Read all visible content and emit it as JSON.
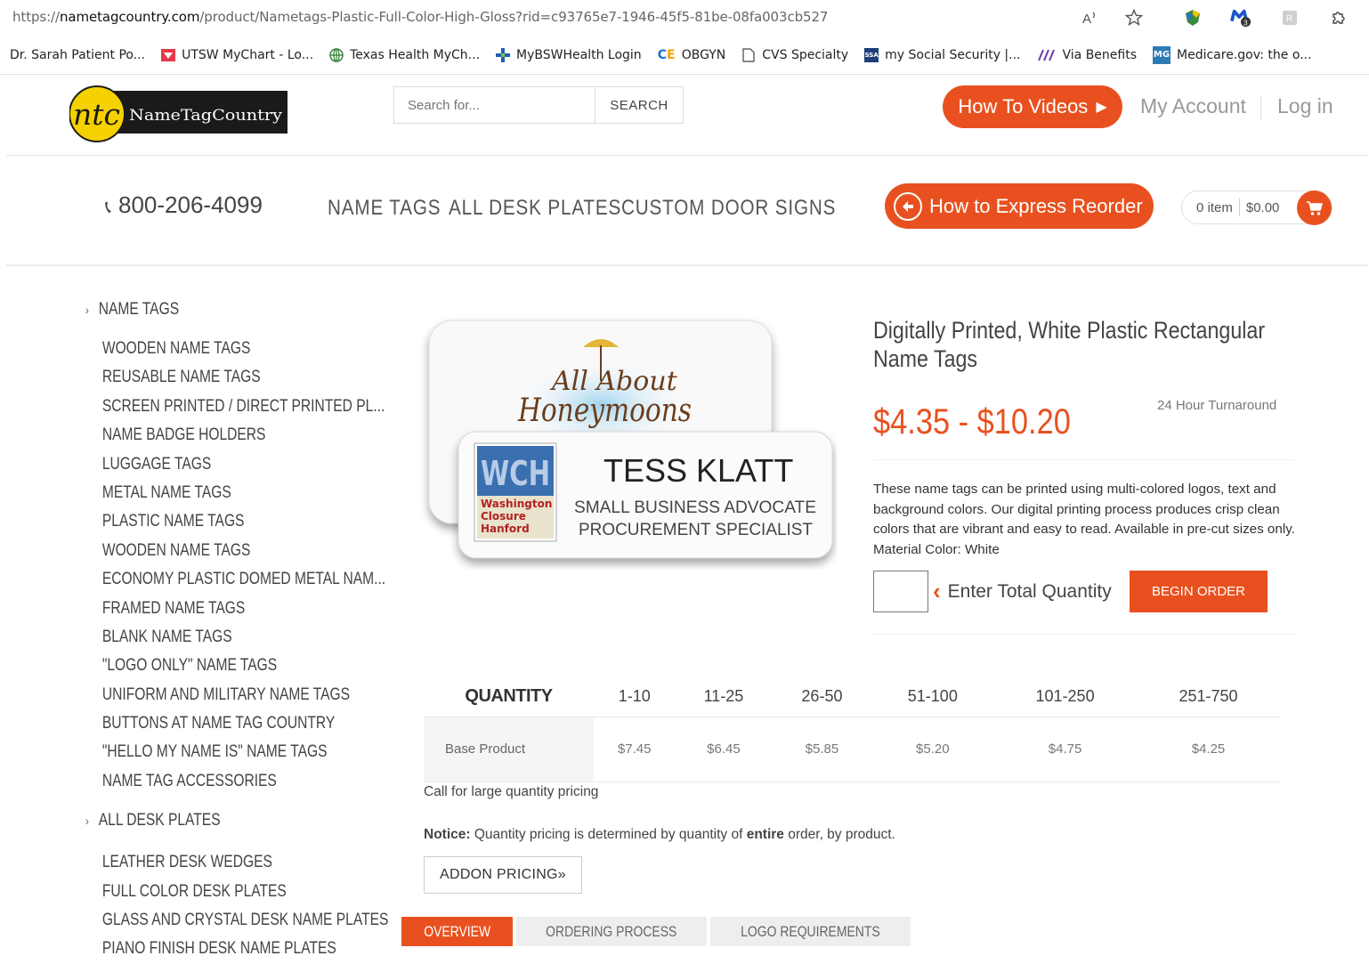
{
  "browser": {
    "url_prefix": "https://",
    "url_domain": "nametagcountry.com",
    "url_path": "/product/Nametags-Plastic-Full-Color-High-Gloss?rid=c93765e7-1946-45f5-81be-08fa003cb527",
    "extension_badge": "3"
  },
  "bookmarks": [
    {
      "label": "Dr. Sarah Patient Po...",
      "icon": "none"
    },
    {
      "label": "UTSW MyChart - Lo...",
      "icon": "utsw-icon"
    },
    {
      "label": "Texas Health MyCh...",
      "icon": "globe-icon"
    },
    {
      "label": "MyBSWHealth Login",
      "icon": "bsw-icon"
    },
    {
      "label": "OBGYN",
      "icon": "ce-icon"
    },
    {
      "label": "CVS Specialty",
      "icon": "page-icon"
    },
    {
      "label": "my Social Security |...",
      "icon": "ssa-icon"
    },
    {
      "label": "Via Benefits",
      "icon": "via-icon"
    },
    {
      "label": "Medicare.gov: the o...",
      "icon": "medicare-icon"
    }
  ],
  "header": {
    "logo_mark": "ntc",
    "logo_text": "NameTagCountry",
    "search_placeholder": "Search for...",
    "search_button": "SEARCH",
    "how_to_videos": "How To Videos",
    "my_account": "My Account",
    "log_in": "Log in"
  },
  "nav": {
    "phone": "800-206-4099",
    "items": [
      "NAME TAGS",
      "ALL DESK PLATES",
      "CUSTOM DOOR SIGNS"
    ],
    "express_reorder": "How to Express Reorder",
    "cart_items": "0 item",
    "cart_total": "$0.00"
  },
  "sidebar": {
    "groups": [
      {
        "heading": "NAME TAGS",
        "items": [
          "WOODEN NAME TAGS",
          "REUSABLE NAME TAGS",
          "SCREEN PRINTED / DIRECT PRINTED PL...",
          "NAME BADGE HOLDERS",
          "LUGGAGE TAGS",
          "METAL NAME TAGS",
          "PLASTIC NAME TAGS",
          "WOODEN NAME TAGS",
          "ECONOMY PLASTIC DOMED METAL NAM...",
          "FRAMED NAME TAGS",
          "BLANK NAME TAGS",
          "\"LOGO ONLY\" NAME TAGS",
          "UNIFORM AND MILITARY NAME TAGS",
          "BUTTONS AT NAME TAG COUNTRY",
          "\"HELLO MY NAME IS\" NAME TAGS",
          "NAME TAG ACCESSORIES"
        ]
      },
      {
        "heading": "ALL DESK PLATES",
        "items": [
          "LEATHER DESK WEDGES",
          "FULL COLOR DESK PLATES",
          "GLASS AND CRYSTAL DESK NAME PLATES",
          "PIANO FINISH DESK NAME PLATES"
        ]
      }
    ]
  },
  "product_image": {
    "back_logo_line1": "All About",
    "back_logo_line2": "Honeymoons",
    "front_logo_mark": "WCH",
    "front_logo_sub1": "Washington",
    "front_logo_sub2": "Closure",
    "front_logo_sub3": "Hanford",
    "front_name": "TESS KLATT",
    "front_title1": "SMALL BUSINESS ADVOCATE",
    "front_title2": "PROCUREMENT SPECIALIST"
  },
  "product": {
    "title_line1": "Digitally Printed, White Plastic Rectangular",
    "title_line2": "Name Tags",
    "price_range": "$4.35 - $10.20",
    "turnaround": "24 Hour Turnaround",
    "description": "These name tags can be printed using multi-colored logos, text and background colors. Our digital printing process produces crisp clean colors that are vibrant and easy to read. Available in pre-cut sizes only. Material Color: White",
    "quantity_prompt": "Enter Total Quantity",
    "begin_order": "BEGIN ORDER"
  },
  "pricing": {
    "quantity_header": "QUANTITY",
    "tiers": [
      "1-10",
      "11-25",
      "26-50",
      "51-100",
      "101-250",
      "251-750"
    ],
    "row_label": "Base Product",
    "prices": [
      "$7.45",
      "$6.45",
      "$5.85",
      "$5.20",
      "$4.75",
      "$4.25"
    ],
    "call_note": "Call for large quantity pricing",
    "notice_label": "Notice:",
    "notice_text_a": " Quantity pricing is determined by quantity of ",
    "notice_bold": "entire",
    "notice_text_b": " order, by product.",
    "addon_button": "ADDON PRICING»"
  },
  "tabs": [
    "OVERVIEW",
    "ORDERING PROCESS",
    "LOGO REQUIREMENTS"
  ],
  "colors": {
    "accent": "#e8511f",
    "logo_yellow": "#f5d100"
  }
}
